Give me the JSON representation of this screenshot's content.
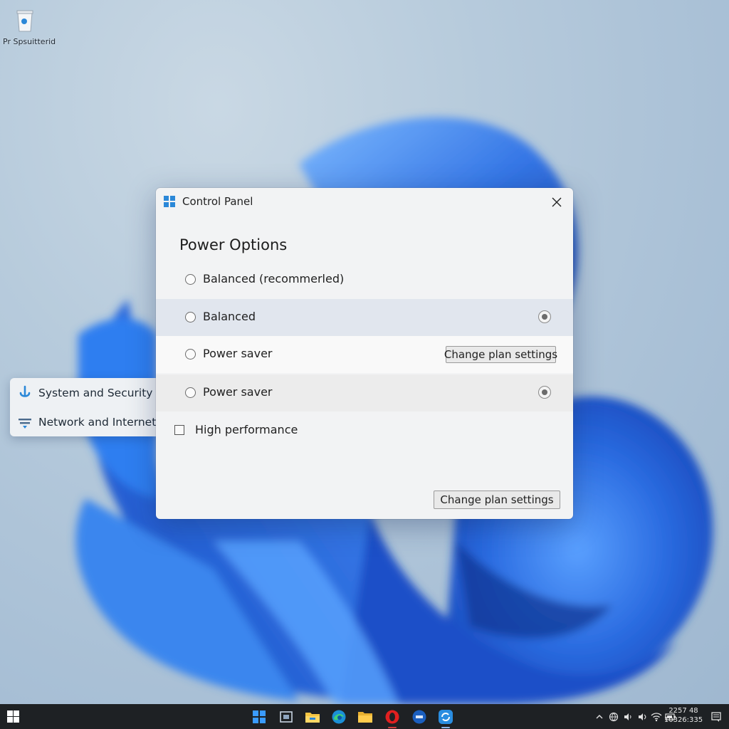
{
  "desktop": {
    "icon_label": "Pr Spsuitterid"
  },
  "flyout": {
    "items": [
      {
        "label": "System and Security",
        "icon": "shield-download-icon"
      },
      {
        "label": "Network and Internet",
        "icon": "network-icon"
      }
    ]
  },
  "dialog": {
    "title": "Control Panel",
    "heading": "Power Options",
    "plans": [
      {
        "label": "Balanced (recommerled)",
        "selected": false
      },
      {
        "label": "Balanced",
        "selected": true
      },
      {
        "label": "Power saver",
        "button": "Change plan settings"
      },
      {
        "label": "Power saver",
        "selected": true
      }
    ],
    "checkbox_label": "High performance",
    "bottom_button": "Change plan settings"
  },
  "taskbar": {
    "apps": [
      "start-icon",
      "task-view-icon",
      "file-explorer-icon",
      "edge-icon",
      "folder-icon",
      "opera-icon",
      "remote-icon",
      "sync-icon"
    ],
    "clock": {
      "time": "2257 48",
      "date": "10326:335"
    }
  },
  "colors": {
    "accent": "#2b88d8",
    "bloom_blue": "#1f5fd6",
    "taskbar": "#1e2124"
  }
}
